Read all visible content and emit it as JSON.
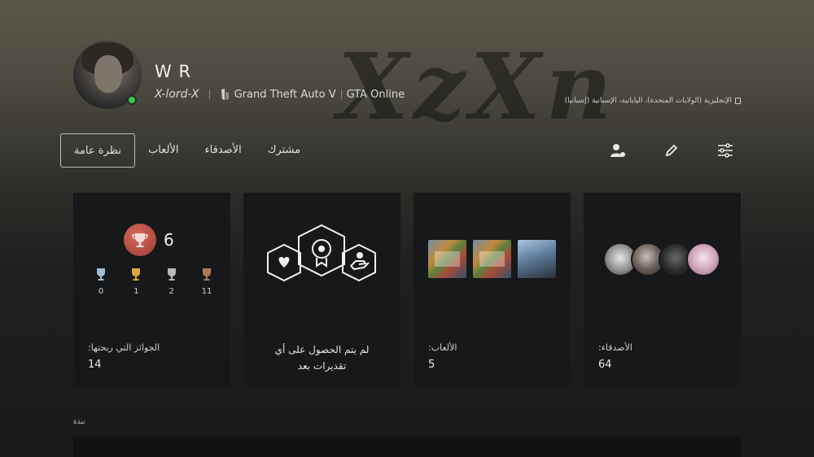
{
  "background_logo_text": "XzXn",
  "profile": {
    "name": "W R",
    "online_id": "X-lord-X",
    "status": "online",
    "presence_game": "Grand Theft Auto V",
    "presence_detail": "GTA Online",
    "languages": "الإنجليزية (الولايات المتحدة)، اليابانية، الإسبانية (إسبانيا)"
  },
  "tabs": [
    "نظرة عامة",
    "الألعاب",
    "الأصدقاء",
    "مشترك"
  ],
  "active_tab": "نظرة عامة",
  "toolbar": {
    "icons": [
      "add-friend-icon",
      "edit-pencil-icon",
      "settings-sliders-icon"
    ]
  },
  "cards": {
    "trophies": {
      "level": "6",
      "platinum": "0",
      "gold": "1",
      "silver": "2",
      "bronze": "11",
      "label": "الجوائز التي ربحتها:",
      "value": "14"
    },
    "accolades": {
      "message": "لم يتم الحصول على أي تقديرات بعد"
    },
    "games": {
      "label": "الألعاب:",
      "value": "5"
    },
    "friends": {
      "label": "الأصدقاء:",
      "value": "64"
    }
  },
  "bio_section": {
    "label": "نبذة"
  },
  "colors": {
    "online": "#2ecc40",
    "card_bg": "#17181a",
    "trophy_level": "#b4473b"
  }
}
